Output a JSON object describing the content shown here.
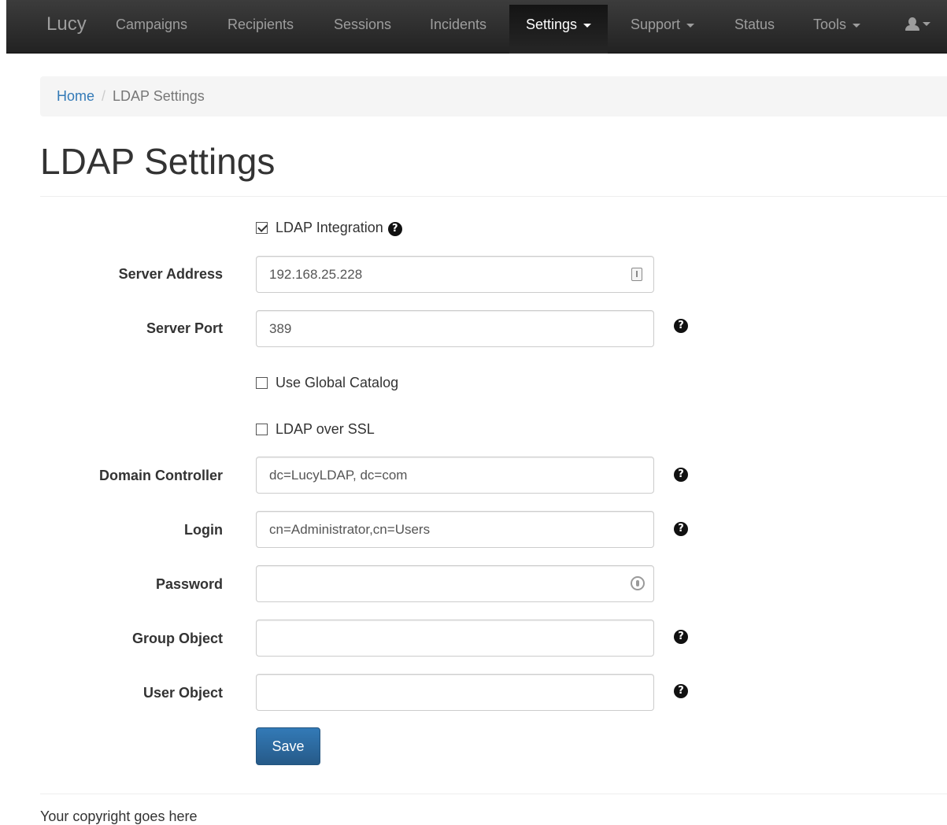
{
  "navbar": {
    "brand": "Lucy",
    "items": [
      {
        "label": "Campaigns"
      },
      {
        "label": "Recipients"
      },
      {
        "label": "Sessions"
      },
      {
        "label": "Incidents"
      },
      {
        "label": "Settings",
        "active": true,
        "dropdown": true
      },
      {
        "label": "Support",
        "dropdown": true
      },
      {
        "label": "Status"
      },
      {
        "label": "Tools",
        "dropdown": true
      }
    ],
    "user_icon": "user-icon"
  },
  "breadcrumb": {
    "home": "Home",
    "separator": "/",
    "current": "LDAP Settings"
  },
  "page": {
    "title": "LDAP Settings"
  },
  "form": {
    "ldap_integration": {
      "label": "LDAP Integration",
      "checked": true
    },
    "server_address": {
      "label": "Server Address",
      "value": "192.168.25.228"
    },
    "server_port": {
      "label": "Server Port",
      "value": "389"
    },
    "use_global_catalog": {
      "label": "Use Global Catalog",
      "checked": false
    },
    "ldap_over_ssl": {
      "label": "LDAP over SSL",
      "checked": false
    },
    "domain_controller": {
      "label": "Domain Controller",
      "value": "dc=LucyLDAP, dc=com"
    },
    "login": {
      "label": "Login",
      "value": "cn=Administrator,cn=Users"
    },
    "password": {
      "label": "Password",
      "value": ""
    },
    "group_object": {
      "label": "Group Object",
      "value": ""
    },
    "user_object": {
      "label": "User Object",
      "value": ""
    },
    "save_label": "Save"
  },
  "footer": {
    "text": "Your copyright goes here"
  },
  "colors": {
    "navbar_bg": "#222222",
    "link": "#337ab7",
    "primary_button": "#337ab7"
  }
}
